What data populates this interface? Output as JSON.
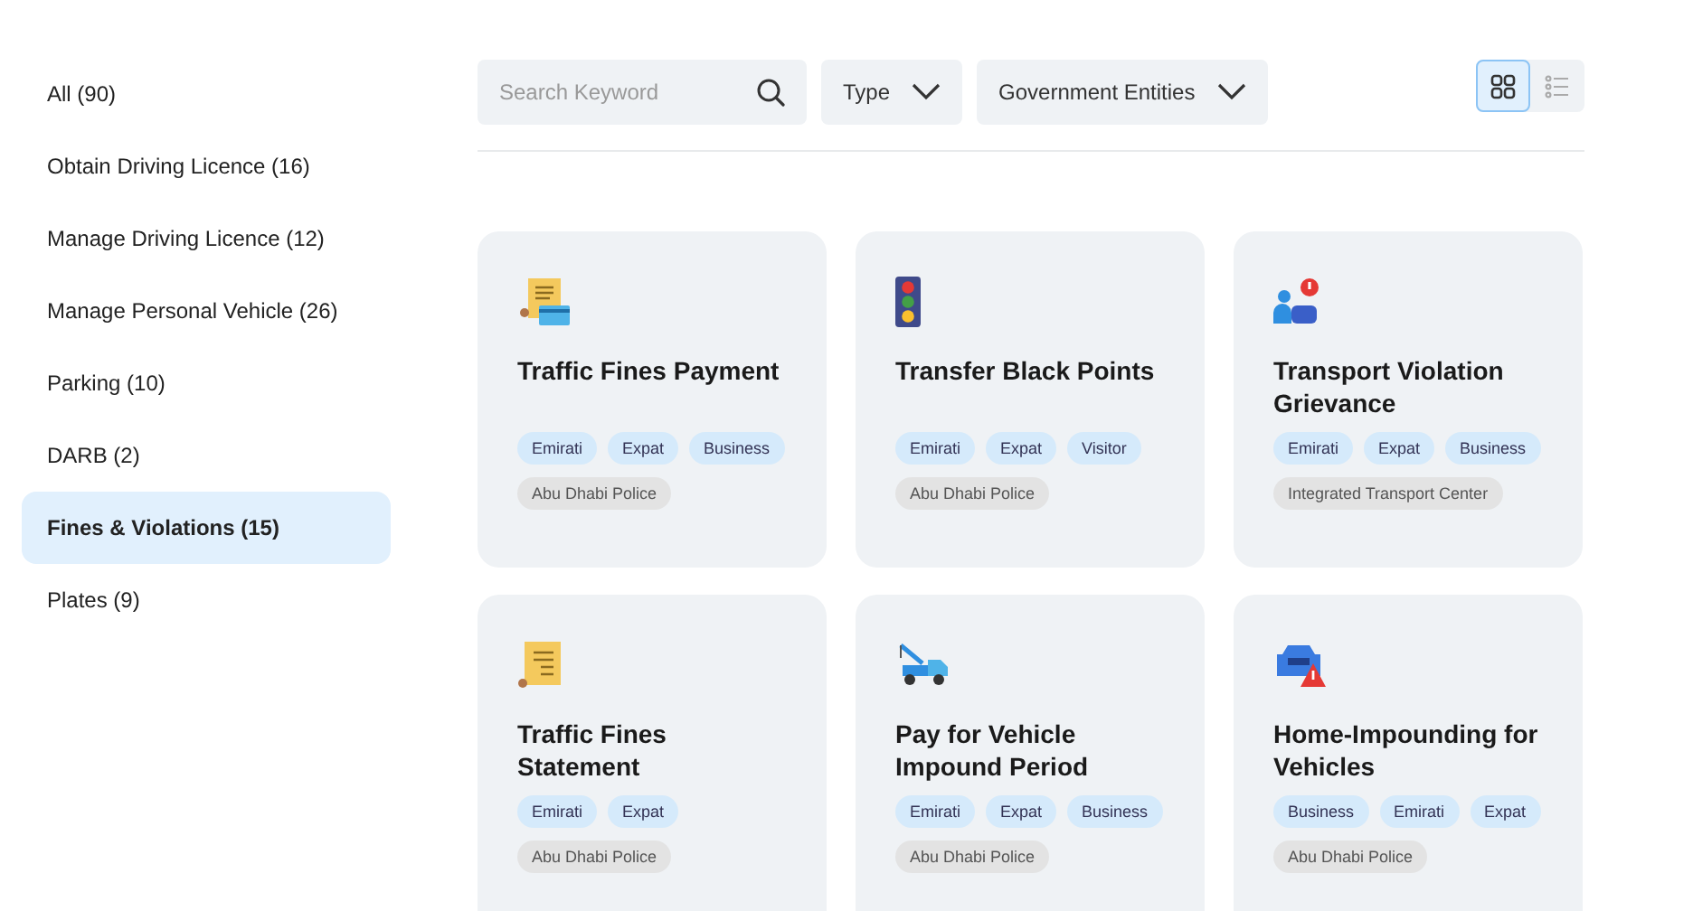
{
  "sidebar": {
    "items": [
      {
        "label": "All (90)",
        "selected": false
      },
      {
        "label": "Obtain Driving Licence (16)",
        "selected": false
      },
      {
        "label": "Manage Driving Licence (12)",
        "selected": false
      },
      {
        "label": "Manage Personal Vehicle (26)",
        "selected": false
      },
      {
        "label": "Parking (10)",
        "selected": false
      },
      {
        "label": "DARB (2)",
        "selected": false
      },
      {
        "label": "Fines & Violations (15)",
        "selected": true
      },
      {
        "label": "Plates (9)",
        "selected": false
      }
    ]
  },
  "toolbar": {
    "search": {
      "placeholder": "Search Keyword"
    },
    "filters": [
      "Type",
      "Government Entities"
    ],
    "views": [
      {
        "kind": "grid",
        "selected": true
      },
      {
        "kind": "list",
        "selected": false
      }
    ]
  },
  "cards": [
    {
      "kind": "receipt-card",
      "title": "Traffic Fines Payment",
      "audiences": [
        "Emirati",
        "Expat",
        "Business"
      ],
      "entity": "Abu Dhabi Police"
    },
    {
      "kind": "traffic-light",
      "title": "Transfer Black Points",
      "audiences": [
        "Emirati",
        "Expat",
        "Visitor"
      ],
      "entity": "Abu Dhabi Police"
    },
    {
      "kind": "person-alert",
      "title": "Transport Violation Grievance",
      "audiences": [
        "Emirati",
        "Expat",
        "Business"
      ],
      "entity": "Integrated Transport Center"
    },
    {
      "kind": "receipt",
      "title": "Traffic Fines Statement",
      "audiences": [
        "Emirati",
        "Expat"
      ],
      "entity": "Abu Dhabi Police"
    },
    {
      "kind": "tow-truck",
      "title": "Pay for Vehicle Impound Period",
      "audiences": [
        "Emirati",
        "Expat",
        "Business"
      ],
      "entity": "Abu Dhabi Police"
    },
    {
      "kind": "car-warning",
      "title": "Home-Impounding for Vehicles",
      "audiences": [
        "Business",
        "Emirati",
        "Expat"
      ],
      "entity": "Abu Dhabi Police"
    }
  ]
}
